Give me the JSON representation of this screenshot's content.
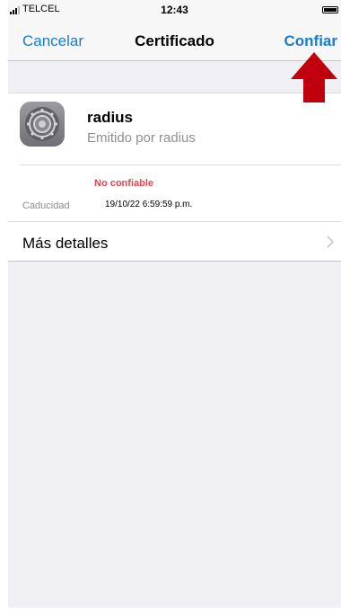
{
  "status_bar": {
    "carrier": "TELCEL",
    "time": "12:43",
    "battery_level": 1.0
  },
  "nav": {
    "cancel_label": "Cancelar",
    "title": "Certificado",
    "trust_label": "Confiar"
  },
  "certificate": {
    "name": "radius",
    "issuer": "Emitido por radius",
    "trust_status": "No confiable",
    "expiry_label": "Caducidad",
    "expiry_value": "19/10/22 6:59:59 p.m.",
    "more_details_label": "Más detalles"
  },
  "colors": {
    "accent": "#1a7ccf",
    "warning": "#e8444a",
    "annotation_arrow": "#c0000d"
  }
}
